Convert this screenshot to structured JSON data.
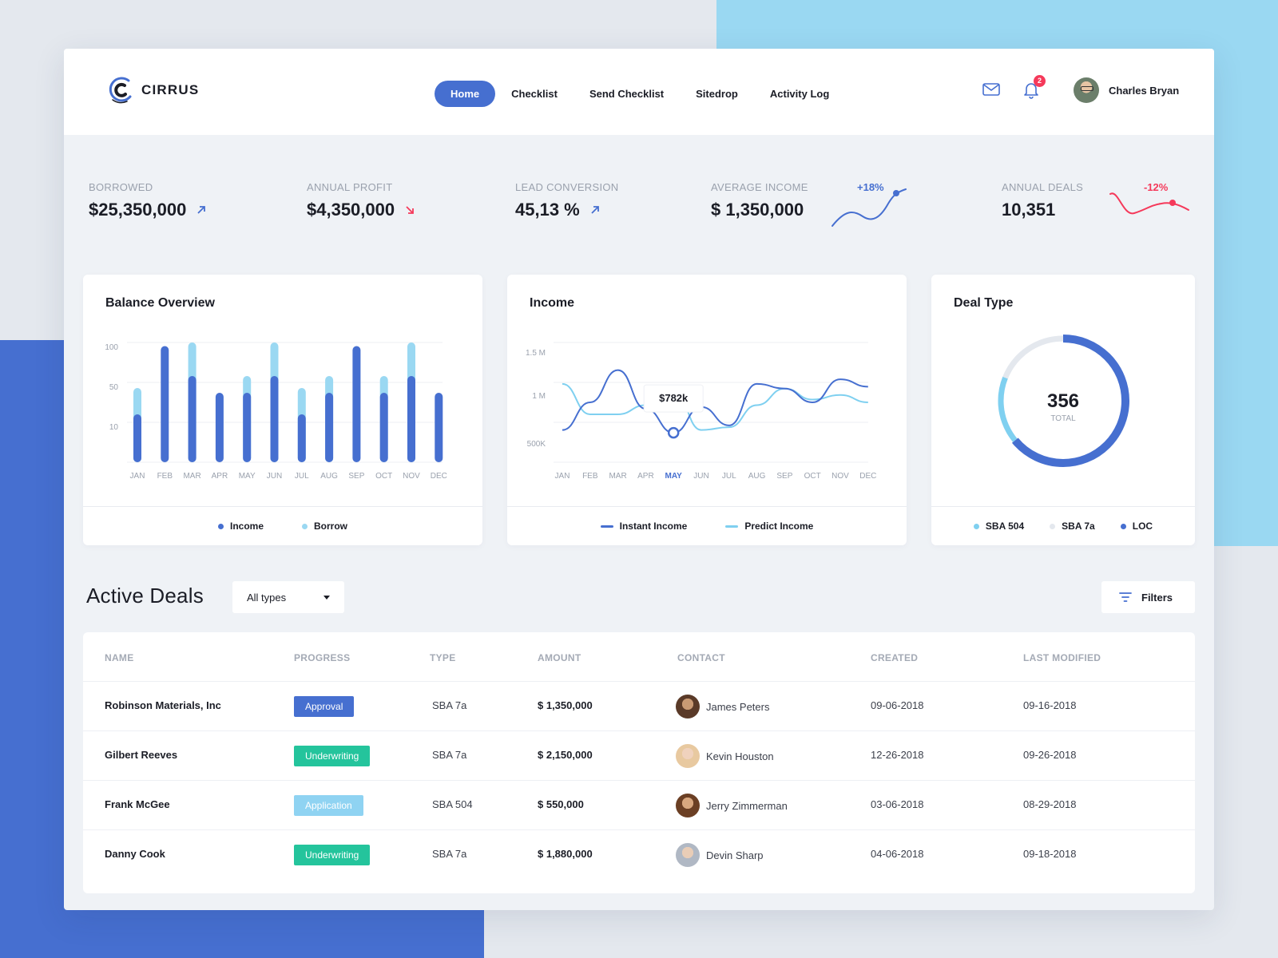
{
  "app": {
    "name": "CIRRUS"
  },
  "nav": [
    "Home",
    "Checklist",
    "Send Checklist",
    "Sitedrop",
    "Activity Log"
  ],
  "notifications": {
    "count": "2"
  },
  "user": {
    "name": "Charles Bryan"
  },
  "stats": [
    {
      "label": "BORROWED",
      "value": "$25,350,000",
      "trend": "up"
    },
    {
      "label": "ANNUAL PROFIT",
      "value": "$4,350,000",
      "trend": "down"
    },
    {
      "label": "LEAD CONVERSION",
      "value": "45,13 %",
      "trend": "up"
    },
    {
      "label": "AVERAGE INCOME",
      "value": "$ 1,350,000",
      "change": "+18%"
    },
    {
      "label": "ANNUAL DEALS",
      "value": "10,351",
      "change": "-12%"
    }
  ],
  "colors": {
    "accent": "#466fd0",
    "light": "#9ad8f2",
    "green": "#24c49c",
    "red": "#f5395a",
    "grey": "#9aa1ad"
  },
  "chart_data": [
    {
      "type": "bar",
      "title": "Balance Overview",
      "categories": [
        "JAN",
        "FEB",
        "MAR",
        "APR",
        "MAY",
        "JUN",
        "JUL",
        "AUG",
        "SEP",
        "OCT",
        "NOV",
        "DEC"
      ],
      "y_ticks": [
        "100",
        "50",
        "10"
      ],
      "series": [
        {
          "name": "Income",
          "values": [
            40,
            97,
            72,
            58,
            58,
            72,
            40,
            58,
            97,
            58,
            72,
            58
          ]
        },
        {
          "name": "Borrow",
          "values": [
            62,
            0,
            100,
            0,
            72,
            100,
            62,
            72,
            0,
            72,
            100,
            0
          ]
        }
      ],
      "legend": "bottom"
    },
    {
      "type": "line",
      "title": "Income",
      "categories": [
        "JAN",
        "FEB",
        "MAR",
        "APR",
        "MAY",
        "JUN",
        "JUL",
        "AUG",
        "SEP",
        "OCT",
        "NOV",
        "DEC"
      ],
      "highlight": {
        "category": "MAY",
        "label": "$782k"
      },
      "y_ticks": [
        "1.5 M",
        "1 M",
        "500K"
      ],
      "series": [
        {
          "name": "Instant Income",
          "values": [
            0.55,
            0.85,
            1.2,
            0.78,
            0.52,
            0.8,
            0.6,
            1.05,
            1.0,
            0.85,
            1.1,
            1.02
          ]
        },
        {
          "name": "Predict Income",
          "values": [
            1.05,
            0.72,
            0.72,
            0.82,
            0.98,
            0.55,
            0.58,
            0.82,
            1.0,
            0.88,
            0.93,
            0.85
          ]
        }
      ],
      "legend": "bottom"
    },
    {
      "type": "pie",
      "title": "Deal Type",
      "total": "356",
      "total_label": "TOTAL",
      "categories": [
        "SBA 504",
        "SBA 7a",
        "LOC"
      ],
      "values": [
        0.17,
        0.19,
        0.64
      ],
      "legend": "bottom"
    }
  ],
  "deals": {
    "title": "Active Deals",
    "type_filter": "All types",
    "filters_label": "Filters",
    "columns": [
      "NAME",
      "PROGRESS",
      "TYPE",
      "AMOUNT",
      "CONTACT",
      "CREATED",
      "LAST MODIFIED"
    ],
    "rows": [
      {
        "name": "Robinson Materials, Inc",
        "progress": "Approval",
        "progress_color": "#466fd0",
        "type": "SBA 7a",
        "amount": "$ 1,350,000",
        "contact": "James Peters",
        "created": "09-06-2018",
        "modified": "09-16-2018"
      },
      {
        "name": "Gilbert Reeves",
        "progress": "Underwriting",
        "progress_color": "#24c49c",
        "type": "SBA 7a",
        "amount": "$ 2,150,000",
        "contact": "Kevin Houston",
        "created": "12-26-2018",
        "modified": "09-26-2018"
      },
      {
        "name": "Frank McGee",
        "progress": "Application",
        "progress_color": "#8fd3f2",
        "type": "SBA 504",
        "amount": "$ 550,000",
        "contact": "Jerry Zimmerman",
        "created": "03-06-2018",
        "modified": "08-29-2018"
      },
      {
        "name": "Danny Cook",
        "progress": "Underwriting",
        "progress_color": "#24c49c",
        "type": "SBA 7a",
        "amount": "$ 1,880,000",
        "contact": "Devin Sharp",
        "created": "04-06-2018",
        "modified": "09-18-2018"
      }
    ]
  }
}
